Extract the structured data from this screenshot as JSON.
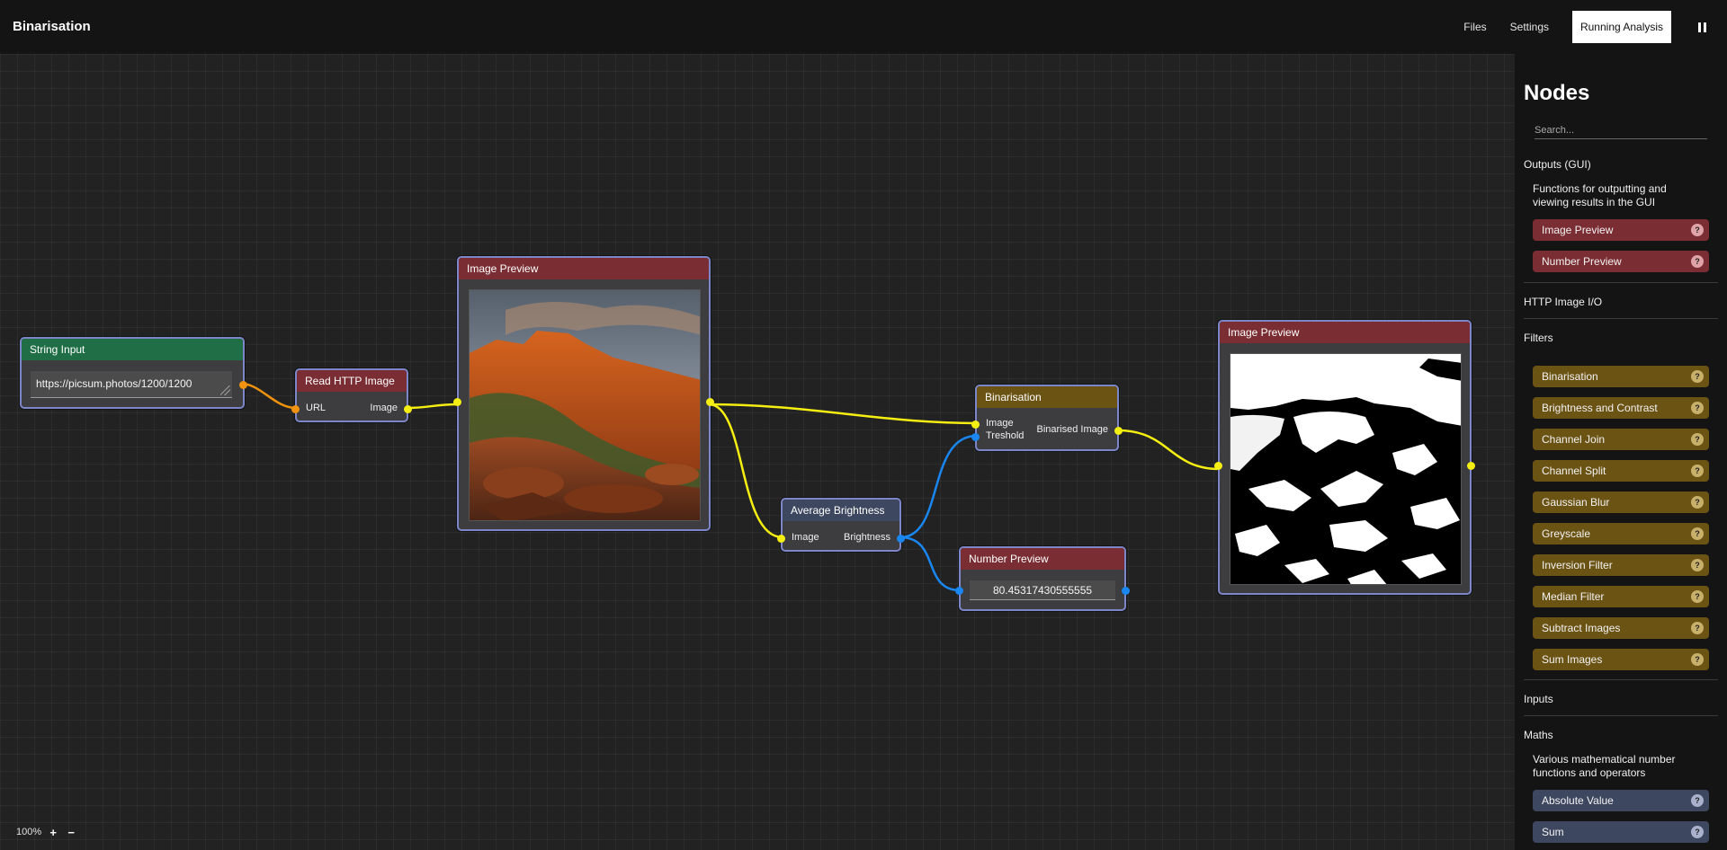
{
  "header": {
    "title": "Binarisation",
    "nav": {
      "files": "Files",
      "settings": "Settings",
      "running": "Running Analysis"
    }
  },
  "canvas": {
    "zoom": "100%",
    "nodes": {
      "string_input": {
        "title": "String Input",
        "value": "https://picsum.photos/1200/1200"
      },
      "read_http": {
        "title": "Read HTTP Image",
        "in_label": "URL",
        "out_label": "Image"
      },
      "image_preview_1": {
        "title": "Image Preview"
      },
      "binarisation": {
        "title": "Binarisation",
        "in_image": "Image",
        "in_threshold": "Treshold",
        "out_label": "Binarised Image"
      },
      "average_brightness": {
        "title": "Average Brightness",
        "in_label": "Image",
        "out_label": "Brightness"
      },
      "number_preview": {
        "title": "Number Preview",
        "value": "80.45317430555555"
      },
      "image_preview_2": {
        "title": "Image Preview"
      }
    }
  },
  "sidebar": {
    "title": "Nodes",
    "search_placeholder": "Search...",
    "outputs": {
      "label": "Outputs (GUI)",
      "description": "Functions for outputting and viewing results in the GUI",
      "items": [
        "Image Preview",
        "Number Preview"
      ]
    },
    "http": {
      "label": "HTTP Image I/O"
    },
    "filters": {
      "label": "Filters",
      "items": [
        "Binarisation",
        "Brightness and Contrast",
        "Channel Join",
        "Channel Split",
        "Gaussian Blur",
        "Greyscale",
        "Inversion Filter",
        "Median Filter",
        "Subtract Images",
        "Sum Images"
      ]
    },
    "inputs": {
      "label": "Inputs"
    },
    "maths": {
      "label": "Maths",
      "description": "Various mathematical number functions and operators",
      "items": [
        "Absolute Value",
        "Sum"
      ]
    },
    "help_glyph": "?"
  },
  "colors": {
    "wire_image": "#f5ee12",
    "wire_string": "#f0920e",
    "wire_number": "#1a86f0",
    "node_border": "#7d86c8",
    "output_red": "#7a2d33",
    "filter_gold": "#6b5314",
    "maths_slate": "#3e4760",
    "input_green": "#1f6e45"
  }
}
